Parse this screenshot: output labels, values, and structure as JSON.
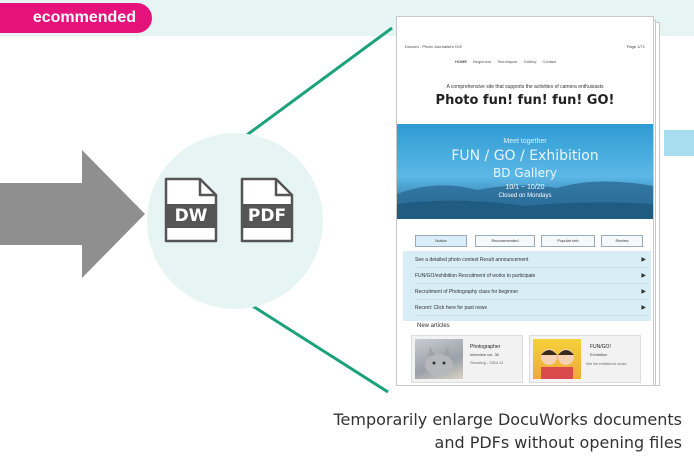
{
  "badge": {
    "label": "ecommended"
  },
  "file_icons": {
    "dw": "DW",
    "pdf": "PDF"
  },
  "preview": {
    "header_left": "Docuen - Photo Journalist's GO!",
    "header_right": "Page 1/71",
    "nav_items": [
      "HOME",
      "Beginners",
      "Techniques",
      "Gallery",
      "Contact"
    ],
    "tagline": "A comprehensive site that supports the activities of camera enthusiasts",
    "site_title": "Photo fun! fun! fun! GO!",
    "banner_small": "Meet together",
    "banner_title": "FUN / GO / Exhibition",
    "banner_sub": "BD Gallery",
    "banner_date": "10/1 ~ 10/20",
    "banner_note": "Closed on Mondays",
    "tabs": [
      "Notice",
      "Recommended",
      "Popular info",
      "Review"
    ],
    "list_items": [
      "See a detailed photo contest Result announcement",
      "FUN/GO/exhibition Recruitment of works to participate",
      "Recruitment of Photography class for beginner",
      "Recent: Click here for past news"
    ],
    "new_articles_label": "New articles",
    "card1": {
      "title": "Photographer",
      "sub": "Interview vol. 36",
      "meta": "Shooting - 2014.11"
    },
    "card2": {
      "title": "FUN/GO!",
      "sub": "Exhibition",
      "meta": "See the exhibition's works"
    }
  },
  "caption": {
    "line1": "Temporarily enlarge DocuWorks documents",
    "line2": "and PDFs without opening files"
  },
  "colors": {
    "accent": "#e6127c",
    "band": "#e6f5f3",
    "line": "#1aa37a",
    "banner": "#2e9bd3",
    "arrow": "#8f8f8f"
  }
}
